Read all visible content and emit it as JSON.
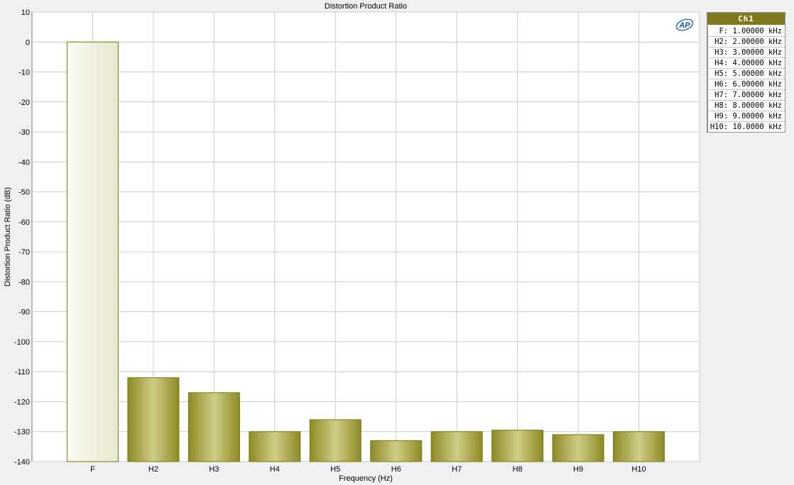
{
  "chart_data": {
    "type": "bar",
    "title": "Distortion Product Ratio",
    "xlabel": "Frequency (Hz)",
    "ylabel": "Distortion Product Ratio (dB)",
    "ylim": [
      -140,
      10
    ],
    "yticks": [
      "10",
      "0",
      "-10",
      "-20",
      "-30",
      "-40",
      "-50",
      "-60",
      "-70",
      "-80",
      "-90",
      "-100",
      "-110",
      "-120",
      "-130",
      "-140"
    ],
    "categories": [
      "F",
      "H2",
      "H3",
      "H4",
      "H5",
      "H6",
      "H7",
      "H8",
      "H9",
      "H10"
    ],
    "series": [
      {
        "values": [
          0,
          -112,
          -117,
          -130,
          -126,
          -133,
          -130,
          -129.5,
          -131,
          -130
        ]
      }
    ],
    "grid": true,
    "colors": {
      "fundamental": "#f4f4e8",
      "harmonic": "#a3a042",
      "outline": "#7a7a10",
      "grid": "#cccccc"
    }
  },
  "legend": {
    "header": "Ch1",
    "rows": [
      "F: 1.00000 kHz",
      "H2: 2.00000 kHz",
      "H3: 3.00000 kHz",
      "H4: 4.00000 kHz",
      "H5: 5.00000 kHz",
      "H6: 6.00000 kHz",
      "H7: 7.00000 kHz",
      "H8: 8.00000 kHz",
      "H9: 9.00000 kHz",
      "H10: 10.0000 kHz"
    ]
  },
  "logo": {
    "text": "AP",
    "icon": "ap-logo-icon"
  }
}
